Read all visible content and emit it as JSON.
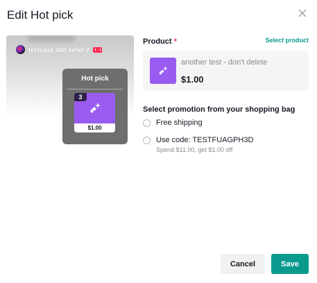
{
  "dialog": {
    "title": "Edit Hot pick",
    "close_icon": "close-icon"
  },
  "preview": {
    "seller_name": "testcase 3dd seller 2",
    "hot_pick_title": "Hot pick",
    "item_number": "3",
    "item_price": "$1.00",
    "item_icon": "product-sparkle-icon"
  },
  "product": {
    "label": "Product",
    "required_marker": "*",
    "select_link": "Select product",
    "name": "another test - don't delete",
    "price": "$1.00",
    "thumb_icon": "product-sparkle-icon"
  },
  "promotion": {
    "heading": "Select promotion from your shopping bag",
    "options": [
      {
        "label": "Free shipping",
        "sublabel": "",
        "selected": false
      },
      {
        "label": "Use code: TESTFUAGPH3D",
        "sublabel": "Spend $11.00, get $1.00 off",
        "selected": false
      }
    ]
  },
  "footer": {
    "cancel_label": "Cancel",
    "save_label": "Save"
  },
  "colors": {
    "accent": "#0a9b8e",
    "required": "#fe2c55",
    "product_purple": "#9a5cf0"
  }
}
